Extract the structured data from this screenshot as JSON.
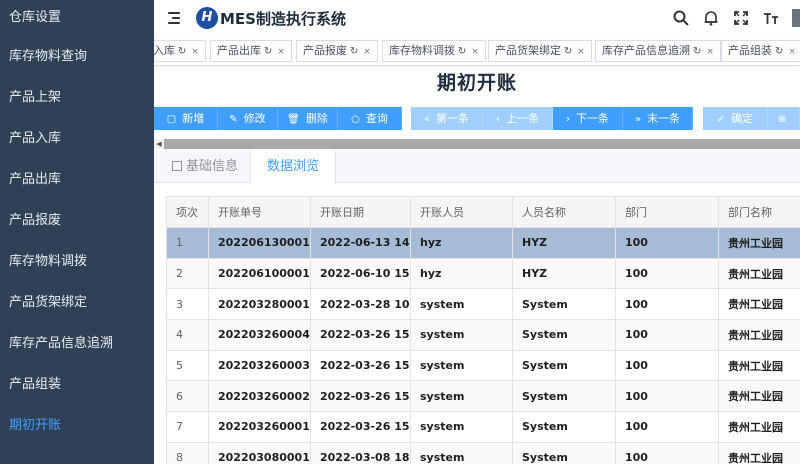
{
  "sidebar": {
    "items": [
      {
        "label": "仓库设置"
      },
      {
        "label": "库存物料查询"
      },
      {
        "label": "产品上架"
      },
      {
        "label": "产品入库"
      },
      {
        "label": "产品出库"
      },
      {
        "label": "产品报废"
      },
      {
        "label": "库存物料调拨"
      },
      {
        "label": "产品货架绑定"
      },
      {
        "label": "库存产品信息追溯"
      },
      {
        "label": "产品组装"
      },
      {
        "label": "期初开账"
      }
    ]
  },
  "header": {
    "logo_letter": "H",
    "title": "MES制造执行系统"
  },
  "tags": [
    {
      "label": "入库"
    },
    {
      "label": "产品出库"
    },
    {
      "label": "产品报废"
    },
    {
      "label": "库存物料调拨"
    },
    {
      "label": "产品货架绑定"
    },
    {
      "label": "库存产品信息追溯"
    },
    {
      "label": "产品组装"
    }
  ],
  "page": {
    "title": "期初开账"
  },
  "toolbar": {
    "add": "新增",
    "edit": "修改",
    "delete": "删除",
    "query": "查询",
    "first": "第一条",
    "prev": "上一条",
    "next": "下一条",
    "last": "末一条",
    "confirm": "确定"
  },
  "tabs": {
    "basic": "基础信息",
    "browse": "数据浏览"
  },
  "table": {
    "columns": [
      "项次",
      "开账单号",
      "开账日期",
      "开账人员",
      "人员名称",
      "部门",
      "部门名称"
    ],
    "rows": [
      [
        "1",
        "202206130001",
        "2022-06-13 14:",
        "hyz",
        "HYZ",
        "100",
        "贵州工业园"
      ],
      [
        "2",
        "202206100001",
        "2022-06-10 15:",
        "hyz",
        "HYZ",
        "100",
        "贵州工业园"
      ],
      [
        "3",
        "202203280001",
        "2022-03-28 10:",
        "system",
        "System",
        "100",
        "贵州工业园"
      ],
      [
        "4",
        "202203260004",
        "2022-03-26 15:",
        "system",
        "System",
        "100",
        "贵州工业园"
      ],
      [
        "5",
        "202203260003",
        "2022-03-26 15:",
        "system",
        "System",
        "100",
        "贵州工业园"
      ],
      [
        "6",
        "202203260002",
        "2022-03-26 15:",
        "system",
        "System",
        "100",
        "贵州工业园"
      ],
      [
        "7",
        "202203260001",
        "2022-03-26 15:",
        "system",
        "System",
        "100",
        "贵州工业园"
      ],
      [
        "8",
        "202203080001",
        "2022-03-08 18:",
        "system",
        "System",
        "100",
        "贵州工业园"
      ]
    ]
  }
}
